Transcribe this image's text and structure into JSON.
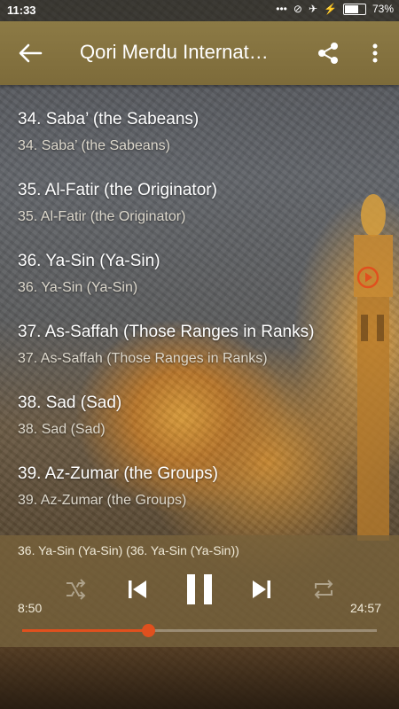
{
  "status_bar": {
    "time": "11:33",
    "battery": "73%",
    "battery_fraction": 0.73,
    "icons": [
      "more-dots-icon",
      "alarm-off-icon",
      "airplane-icon",
      "charging-icon",
      "battery-icon"
    ]
  },
  "toolbar": {
    "title": "Qori Merdu Internat…",
    "color": "#8c7a45",
    "icons": [
      "back-arrow-icon",
      "share-icon",
      "more-vert-icon"
    ]
  },
  "list": {
    "items": [
      {
        "title": "34. Saba’ (the Sabeans)",
        "subtitle": "34. Saba’ (the Sabeans)"
      },
      {
        "title": "35. Al-Fatir (the Originator)",
        "subtitle": "35. Al-Fatir (the Originator)"
      },
      {
        "title": "36. Ya-Sin (Ya-Sin)",
        "subtitle": "36. Ya-Sin (Ya-Sin)",
        "playing": true
      },
      {
        "title": "37. As-Saffah (Those Ranges in Ranks)",
        "subtitle": "37. As-Saffah (Those Ranges in Ranks)"
      },
      {
        "title": "38. Sad (Sad)",
        "subtitle": "38. Sad (Sad)"
      },
      {
        "title": "39. Az-Zumar (the Groups)",
        "subtitle": "39. Az-Zumar (the Groups)"
      }
    ],
    "playing_icon": "play-circle-icon",
    "accent_color": "#e0501e"
  },
  "player": {
    "now_playing": "36. Ya-Sin (Ya-Sin) (36. Ya-Sin (Ya-Sin))",
    "elapsed": "8:50",
    "total": "24:57",
    "progress_fraction": 0.354,
    "controls": [
      "shuffle-icon",
      "previous-icon",
      "pause-icon",
      "next-icon",
      "repeat-icon"
    ]
  }
}
